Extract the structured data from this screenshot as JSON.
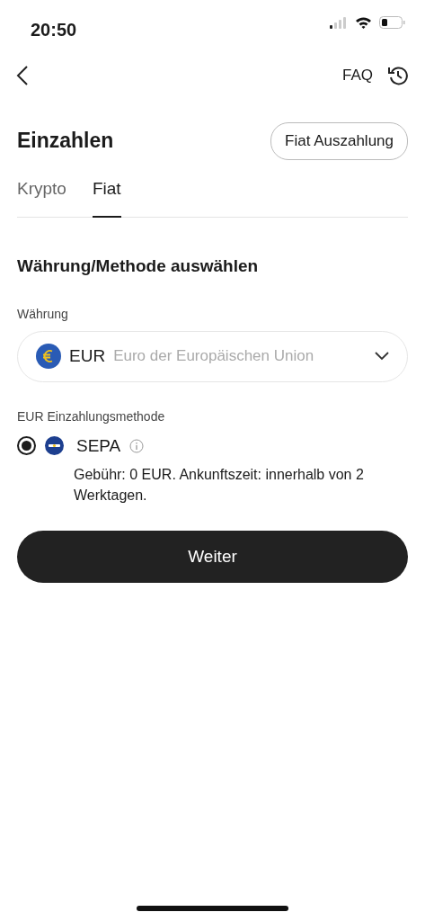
{
  "status_bar": {
    "time": "20:50"
  },
  "nav": {
    "faq": "FAQ"
  },
  "header": {
    "title": "Einzahlen",
    "action": "Fiat Auszahlung"
  },
  "tabs": [
    {
      "label": "Krypto",
      "selected": false
    },
    {
      "label": "Fiat",
      "selected": true
    }
  ],
  "section_title": "Währung/Methode auswählen",
  "currency": {
    "label": "Währung",
    "code": "EUR",
    "name": "Euro der Europäischen Union"
  },
  "method_label": "EUR Einzahlungsmethode",
  "methods": [
    {
      "name": "SEPA",
      "selected": true,
      "description": "Gebühr: 0 EUR. Ankunftszeit: innerhalb von 2 Werktagen."
    }
  ],
  "submit": "Weiter"
}
